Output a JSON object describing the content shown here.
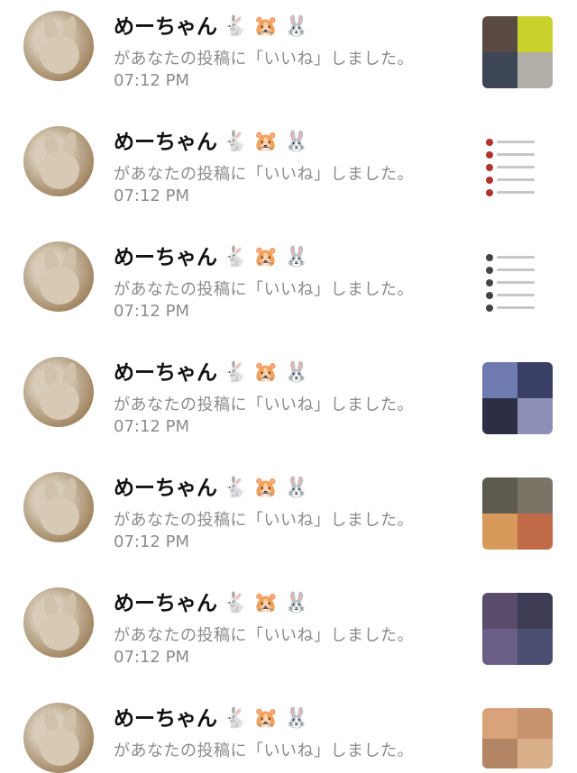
{
  "notifications": [
    {
      "name": "めーちゃん",
      "emojis": [
        "🐇",
        "🐹",
        "🐰"
      ],
      "message": "があなたの投稿に「いいね」しました。",
      "time": "07:12 PM",
      "thumb_style": "t1"
    },
    {
      "name": "めーちゃん",
      "emojis": [
        "🐇",
        "🐹",
        "🐰"
      ],
      "message": "があなたの投稿に「いいね」しました。",
      "time": "07:12 PM",
      "thumb_style": "t2"
    },
    {
      "name": "めーちゃん",
      "emojis": [
        "🐇",
        "🐹",
        "🐰"
      ],
      "message": "があなたの投稿に「いいね」しました。",
      "time": "07:12 PM",
      "thumb_style": "t3"
    },
    {
      "name": "めーちゃん",
      "emojis": [
        "🐇",
        "🐹",
        "🐰"
      ],
      "message": "があなたの投稿に「いいね」しました。",
      "time": "07:12 PM",
      "thumb_style": "t4"
    },
    {
      "name": "めーちゃん",
      "emojis": [
        "🐇",
        "🐹",
        "🐰"
      ],
      "message": "があなたの投稿に「いいね」しました。",
      "time": "07:12 PM",
      "thumb_style": "t5"
    },
    {
      "name": "めーちゃん",
      "emojis": [
        "🐇",
        "🐹",
        "🐰"
      ],
      "message": "があなたの投稿に「いいね」しました。",
      "time": "07:12 PM",
      "thumb_style": "t6"
    },
    {
      "name": "めーちゃん",
      "emojis": [
        "🐇",
        "🐹",
        "🐰"
      ],
      "message": "があなたの投稿に「いいね」しました。",
      "time": "",
      "thumb_style": "t7"
    }
  ]
}
